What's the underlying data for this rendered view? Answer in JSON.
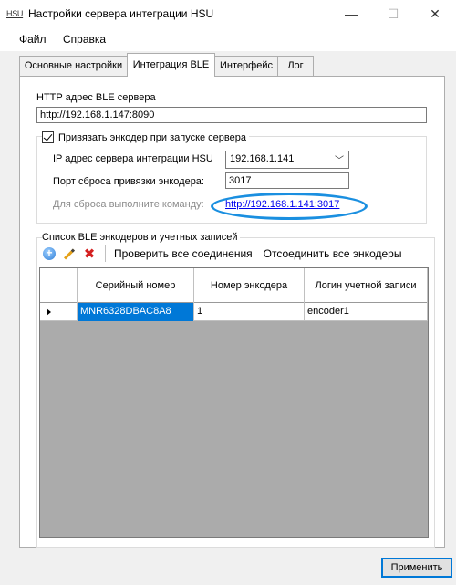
{
  "window": {
    "app_icon_text": "HSU",
    "title": "Настройки сервера интеграции HSU",
    "min_symbol": "—",
    "max_symbol": "☐",
    "close_symbol": "✕"
  },
  "menu": {
    "file": "Файл",
    "help": "Справка"
  },
  "tabs": [
    {
      "label": "Основные настройки",
      "active": false
    },
    {
      "label": "Интеграция BLE",
      "active": true
    },
    {
      "label": "Интерфейс",
      "active": false
    },
    {
      "label": "Лог",
      "active": false
    }
  ],
  "ble": {
    "http_label": "HTTP адрес BLE сервера",
    "http_value": "http://192.168.1.147:8090",
    "bind_checkbox_label": "Привязать энкодер при запуске сервера",
    "bind_checked": true,
    "ip_label": "IP адрес сервера интеграции HSU",
    "ip_value": "192.168.1.141",
    "port_label": "Порт сброса привязки энкодера:",
    "port_value": "3017",
    "reset_label": "Для сброса выполните команду:",
    "reset_link": "http://192.168.1.141:3017"
  },
  "encoders": {
    "group_label": "Список BLE энкодеров и учетных записей",
    "toolbar": {
      "add_icon": "add-circle-icon",
      "edit_icon": "pencil-icon",
      "delete_icon": "delete-x-icon",
      "check_all": "Проверить все соединения",
      "disconnect_all": "Отсоединить все энкодеры"
    },
    "columns": [
      "Серийный номер",
      "Номер энкодера",
      "Логин учетной записи"
    ],
    "rows": [
      {
        "serial": "MNR6328DBAC8A8",
        "number": "1",
        "login": "encoder1"
      }
    ]
  },
  "apply_label": "Применить",
  "colors": {
    "accent": "#0078d7",
    "highlight_oval": "#1a8fe0",
    "link": "#0000ee",
    "grid_bg": "#ababab"
  }
}
